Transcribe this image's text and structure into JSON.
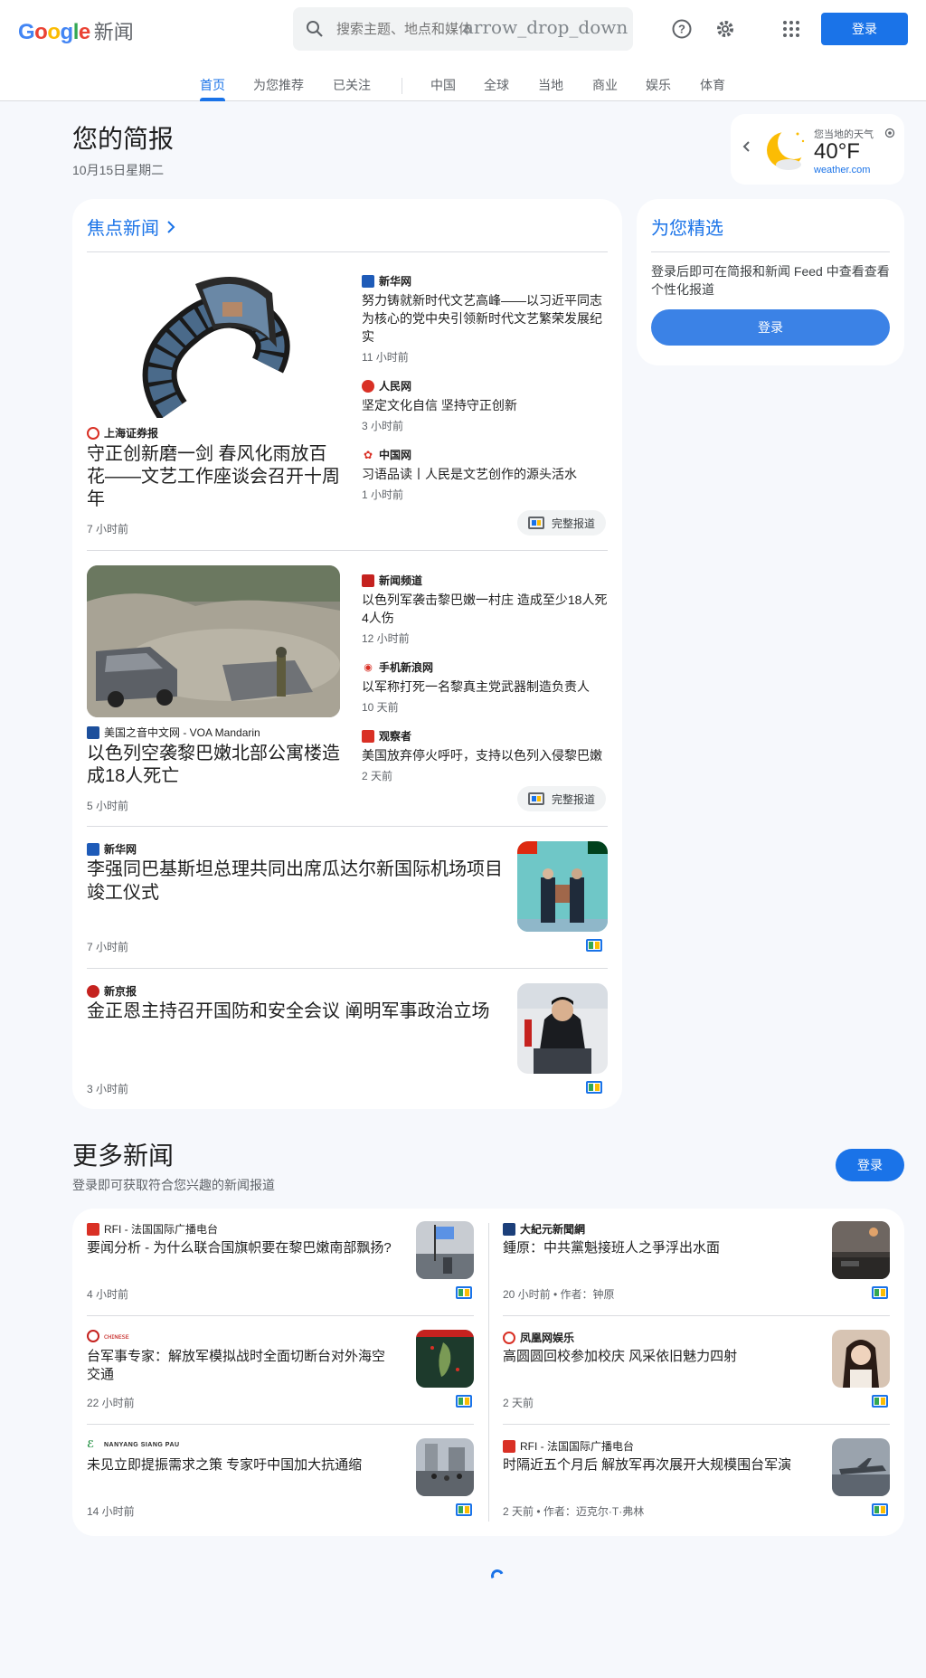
{
  "header": {
    "logo_google": "Google",
    "logo_news": "新闻",
    "search_placeholder": "搜索主题、地点和媒体",
    "search_overlay": "arrow_drop_down",
    "signin": "登录",
    "icons": [
      "search-icon",
      "help-icon",
      "settings-icon",
      "apps-icon"
    ]
  },
  "nav": [
    "首页",
    "为您推荐",
    "已关注",
    "中国",
    "全球",
    "当地",
    "商业",
    "娱乐",
    "体育"
  ],
  "briefing": {
    "title": "您的简报",
    "date": "10月15日星期二"
  },
  "weather": {
    "label": "您当地的天气",
    "temp": "40°F",
    "source": "weather.com"
  },
  "headlines": {
    "title": "焦点新闻",
    "cluster1": {
      "main_source": "上海证券报",
      "main_title": "守正创新磨一剑 春风化雨放百花——文艺工作座谈会召开十周年",
      "main_time": "7 小时前",
      "related": [
        {
          "source": "新华网",
          "title": "努力铸就新时代文艺高峰——以习近平同志为核心的党中央引领新时代文艺繁荣发展纪实",
          "time": "11 小时前"
        },
        {
          "source": "人民网",
          "title": "坚定文化自信 坚持守正创新",
          "time": "3 小时前"
        },
        {
          "source": "中国网",
          "title": "习语品读丨人民是文艺创作的源头活水",
          "time": "1 小时前"
        }
      ],
      "full_coverage": "完整报道"
    },
    "cluster2": {
      "main_source": "美国之音中文网 - VOA Mandarin",
      "main_title": "以色列空袭黎巴嫩北部公寓楼造成18人死亡",
      "main_time": "5 小时前",
      "related": [
        {
          "source": "新闻频道",
          "title": "以色列军袭击黎巴嫩一村庄 造成至少18人死4人伤",
          "time": "12 小时前"
        },
        {
          "source": "手机新浪网",
          "title": "以军称打死一名黎真主党武器制造负责人",
          "time": "10 天前"
        },
        {
          "source": "观察者",
          "title": "美国放弃停火呼吁，支持以色列入侵黎巴嫩",
          "time": "2 天前"
        }
      ],
      "full_coverage": "完整报道"
    },
    "single1": {
      "source": "新华网",
      "title": "李强同巴基斯坦总理共同出席瓜达尔新国际机场项目竣工仪式",
      "time": "7 小时前"
    },
    "single2": {
      "source": "新京报",
      "title": "金正恩主持召开国防和安全会议 阐明军事政治立场",
      "time": "3 小时前"
    }
  },
  "foryou": {
    "title": "为您精选",
    "text": "登录后即可在简报和新闻 Feed 中查看查看个性化报道",
    "button": "登录"
  },
  "more": {
    "title": "更多新闻",
    "subtitle": "登录即可获取符合您兴趣的新闻报道",
    "button": "登录",
    "items": [
      {
        "source": "RFI - 法国国际广播电台",
        "title": "要闻分析 - 为什么联合国旗帜要在黎巴嫩南部飘扬?",
        "time": "4 小时前"
      },
      {
        "source": "大紀元新聞網",
        "title": "鍾原：中共黨魁接班人之爭浮出水面",
        "time": "20 小时前 • 作者：钟原"
      },
      {
        "source": "",
        "title": "台军事专家：解放军模拟战时全面切断台对外海空交通",
        "time": "22 小时前"
      },
      {
        "source": "凤凰网娱乐",
        "title": "高圆圆回校参加校庆 风采依旧魅力四射",
        "time": "2 天前"
      },
      {
        "source": "NANYANG SIANG PAU",
        "title": "未见立即提振需求之策 专家吁中国加大抗通缩",
        "time": "14 小时前"
      },
      {
        "source": "RFI - 法国国际广播电台",
        "title": "时隔近五个月后 解放军再次展开大规模围台军演",
        "time": "2 天前 • 作者：迈克尔·T·弗林"
      }
    ]
  },
  "colors": {
    "accent": "#1a73e8",
    "background": "#f6f8fc",
    "card": "#ffffff"
  }
}
